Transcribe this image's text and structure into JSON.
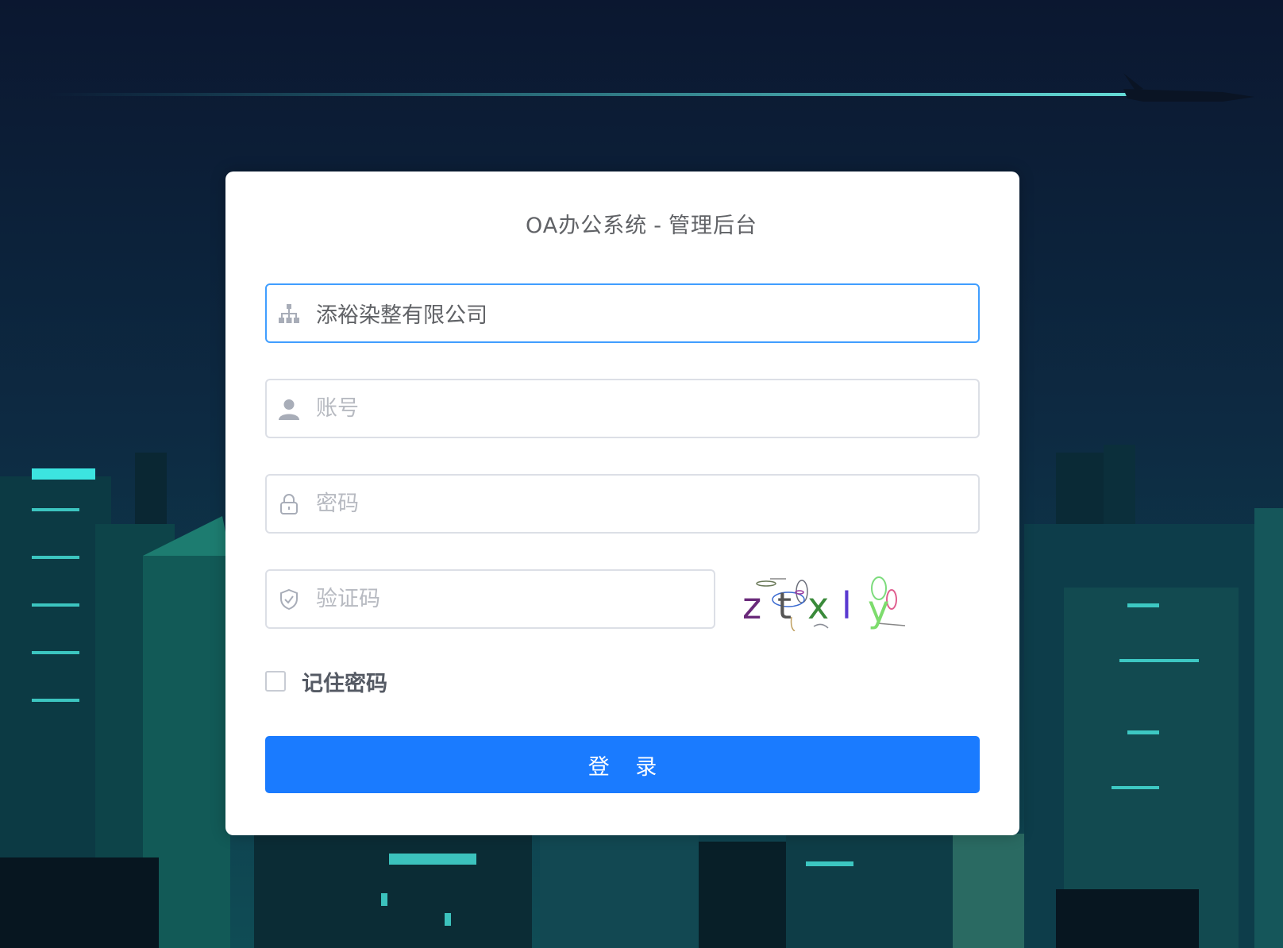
{
  "title": {
    "app": "OA办公系统",
    "separator": "-",
    "section": "管理后台"
  },
  "form": {
    "company": {
      "value": "添裕染整有限公司",
      "icon": "org-chart-icon"
    },
    "account": {
      "value": "",
      "placeholder": "账号",
      "icon": "user-icon"
    },
    "password": {
      "value": "",
      "placeholder": "密码",
      "icon": "lock-icon"
    },
    "captcha": {
      "value": "",
      "placeholder": "验证码",
      "icon": "shield-check-icon",
      "image_text": "ztxly"
    },
    "remember": {
      "label": "记住密码",
      "checked": false
    },
    "submit_label": "登 录"
  },
  "colors": {
    "primary": "#1a7bff",
    "focus_border": "#409eff",
    "text": "#606266",
    "placeholder": "#b7bac1"
  }
}
